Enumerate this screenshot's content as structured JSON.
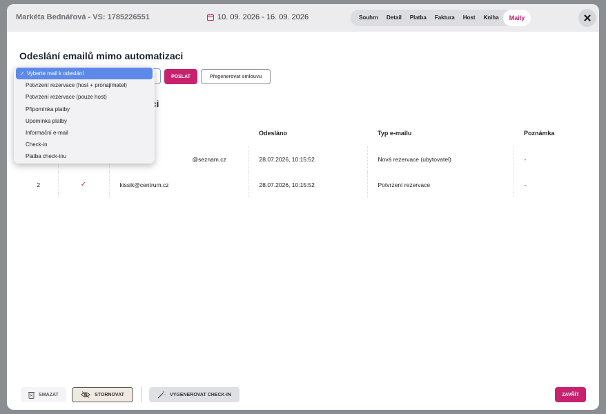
{
  "header": {
    "guest": "Markéta Bednářová - VS: 1785226551",
    "dates": "10. 09. 2026 - 16. 09. 2026",
    "tabs": [
      "Souhrn",
      "Detail",
      "Platba",
      "Faktura",
      "Host",
      "Kniha",
      "Maily"
    ],
    "active_tab": "Maily",
    "close_icon": "x-icon"
  },
  "send_section": {
    "title": "Odeslání emailů mimo automatizaci",
    "send_label": "POSLAT",
    "regenerate_label": "Přegenerovat smlouvu",
    "dropdown": {
      "selected": "Vyberte mail k odeslání",
      "options": [
        "Vyberte mail k odeslání",
        "Potvrzení rezervace (host + pronajímatel)",
        "Potvrzení rezervace (pouze host)",
        "Připomínka platby",
        "Upomínka platby",
        "Informační e-mail",
        "Check-in",
        "Platba check-inu"
      ]
    }
  },
  "history": {
    "title_visible_part": "rvaci",
    "columns": [
      "",
      "",
      "",
      "Odesláno",
      "Typ e-mailu",
      "Poznámka"
    ],
    "rows": [
      {
        "num": "",
        "delivered": "",
        "email": "@seznam.cz",
        "sent": "28.07.2026, 10:15:52",
        "type": "Nová rezervace (ubytovatel)",
        "note": "-"
      },
      {
        "num": "2",
        "delivered": "✓",
        "email": "kissik@centrum.cz",
        "sent": "28.07.2026, 10:15:52",
        "type": "Potvrzení rezervace",
        "note": "-"
      }
    ]
  },
  "footer": {
    "delete_label": "SMAZAT",
    "cancel_label": "STORNOVAT",
    "checkin_label": "VYGENEROVAT CHECK-IN",
    "close_label": "ZAVŘÍT"
  },
  "colors": {
    "accent": "#c8226f",
    "selected_option": "#5d89e8",
    "header_bg": "#ececef"
  }
}
